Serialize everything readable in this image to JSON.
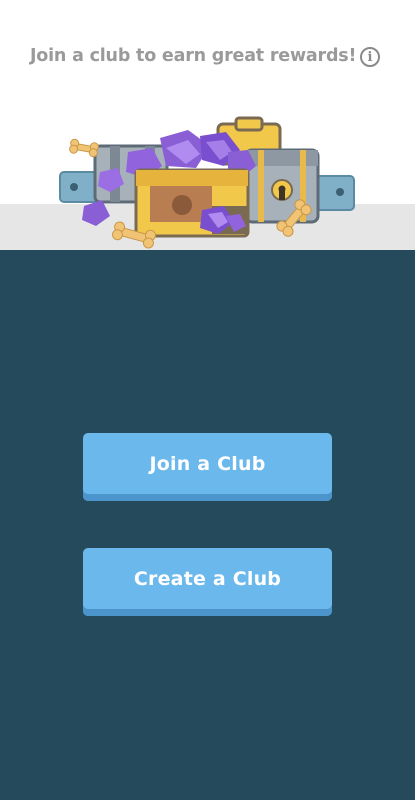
{
  "header": {
    "message": "Join a club to earn great rewards!",
    "info_icon_glyph": "i",
    "info_icon": "info-icon"
  },
  "hero": {
    "illustration": "treasure-chests-with-gems-and-dog-bones"
  },
  "actions": {
    "join_label": "Join a Club",
    "create_label": "Create a Club"
  },
  "colors": {
    "background_dark": "#244a5c",
    "button": "#6bb8ed",
    "button_shadow": "#4b95cc",
    "header_text": "#9a9a9a"
  }
}
